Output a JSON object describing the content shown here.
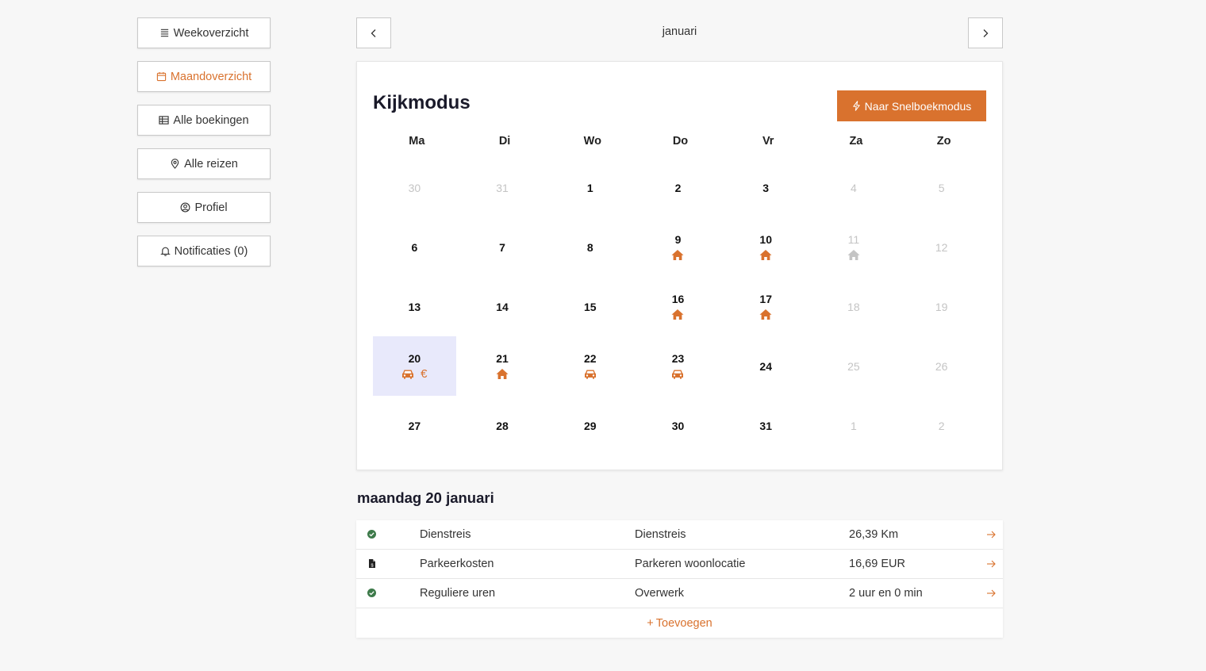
{
  "colors": {
    "accent": "#d9722e",
    "muted": "#c4c4c4",
    "selected_bg": "#e8e9fb",
    "success": "#3d7a4a"
  },
  "sidebar": {
    "items": [
      {
        "label": "Weekoverzicht",
        "icon": "list-icon"
      },
      {
        "label": "Maandoverzicht",
        "icon": "calendar-icon",
        "active": true
      },
      {
        "label": "Alle boekingen",
        "icon": "table-icon"
      },
      {
        "label": "Alle reizen",
        "icon": "location-pin-icon"
      },
      {
        "label": "Profiel",
        "icon": "user-circle-icon"
      },
      {
        "label": "Notificaties (0)",
        "icon": "bell-icon"
      }
    ]
  },
  "header": {
    "month": "januari"
  },
  "calendar": {
    "title": "Kijkmodus",
    "quick_button": "Naar Snelboekmodus",
    "weekdays": [
      "Ma",
      "Di",
      "Wo",
      "Do",
      "Vr",
      "Za",
      "Zo"
    ],
    "weeks": [
      [
        {
          "num": "30",
          "muted": true,
          "icons": []
        },
        {
          "num": "31",
          "muted": true,
          "icons": []
        },
        {
          "num": "1",
          "icons": []
        },
        {
          "num": "2",
          "icons": []
        },
        {
          "num": "3",
          "icons": []
        },
        {
          "num": "4",
          "muted": true,
          "icons": []
        },
        {
          "num": "5",
          "muted": true,
          "icons": []
        }
      ],
      [
        {
          "num": "6",
          "icons": []
        },
        {
          "num": "7",
          "icons": []
        },
        {
          "num": "8",
          "icons": []
        },
        {
          "num": "9",
          "icons": [
            "home"
          ]
        },
        {
          "num": "10",
          "icons": [
            "home"
          ]
        },
        {
          "num": "11",
          "muted": true,
          "icons": [
            "home-muted"
          ]
        },
        {
          "num": "12",
          "muted": true,
          "icons": []
        }
      ],
      [
        {
          "num": "13",
          "icons": []
        },
        {
          "num": "14",
          "icons": []
        },
        {
          "num": "15",
          "icons": []
        },
        {
          "num": "16",
          "icons": [
            "home"
          ]
        },
        {
          "num": "17",
          "icons": [
            "home"
          ]
        },
        {
          "num": "18",
          "muted": true,
          "icons": []
        },
        {
          "num": "19",
          "muted": true,
          "icons": []
        }
      ],
      [
        {
          "num": "20",
          "selected": true,
          "icons": [
            "car",
            "euro"
          ]
        },
        {
          "num": "21",
          "icons": [
            "home"
          ]
        },
        {
          "num": "22",
          "icons": [
            "car"
          ]
        },
        {
          "num": "23",
          "icons": [
            "car"
          ]
        },
        {
          "num": "24",
          "icons": []
        },
        {
          "num": "25",
          "muted": true,
          "icons": []
        },
        {
          "num": "26",
          "muted": true,
          "icons": []
        }
      ],
      [
        {
          "num": "27",
          "icons": []
        },
        {
          "num": "28",
          "icons": []
        },
        {
          "num": "29",
          "icons": []
        },
        {
          "num": "30",
          "icons": []
        },
        {
          "num": "31",
          "icons": []
        },
        {
          "num": "1",
          "muted": true,
          "icons": []
        },
        {
          "num": "2",
          "muted": true,
          "icons": []
        }
      ]
    ],
    "euro_symbol": "€"
  },
  "detail": {
    "title": "maandag 20 januari",
    "rows": [
      {
        "status": "check-circle-icon",
        "type": "Dienstreis",
        "category": "Dienstreis",
        "value": "26,39 Km"
      },
      {
        "status": "document-icon",
        "type": "Parkeerkosten",
        "category": "Parkeren woonlocatie",
        "value": "16,69 EUR"
      },
      {
        "status": "check-circle-icon",
        "type": "Reguliere uren",
        "category": "Overwerk",
        "value": "2 uur en 0 min"
      }
    ],
    "add_label": "Toevoegen",
    "add_symbol": "+"
  }
}
